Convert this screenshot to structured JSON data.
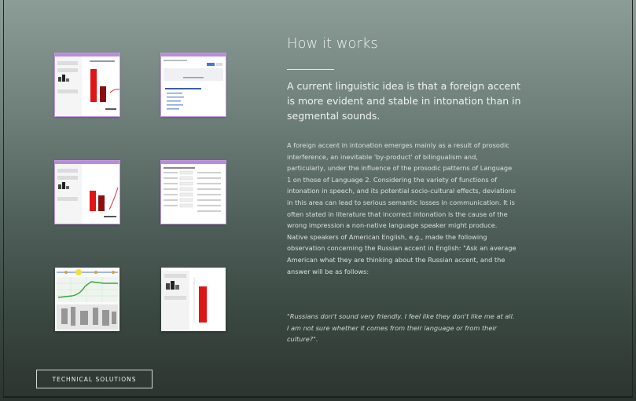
{
  "section": {
    "heading": "How it works",
    "lead": "A current linguistic idea is that a foreign accent is more evident and stable in intonation than in segmental sounds.",
    "body": "A foreign accent in intonation emerges mainly as a result of prosodic interference, an inevitable 'by-product' of bilingualism and, particularly, under the influence of the prosodic patterns of Language 1 on those of Language 2. Considering the variety of functions of intonation in speech, and its potential socio-cultural effects, deviations in this area can lead to serious semantic losses in communication. It is often stated in literature that incorrect intonation is the cause of the wrong impression a non-native language speaker might produce. Native speakers of American English, e.g., made the following observation concerning the Russian accent in English: \"Ask an average American what they are thinking about the Russian accent, and the answer will be as follows:",
    "quote": "\"Russians don't sound very friendly. I feel like they don't like me at all. I am not sure whether it comes from their language or from their culture?\"."
  },
  "screenshots": {
    "thumb_2": {
      "title": "English"
    }
  },
  "buttons": {
    "technical_solutions": "TECHNICAL SOLUTIONS"
  },
  "colors": {
    "accent_purple": "#b98bd8",
    "bar_red": "#e01515",
    "bar_dark_red": "#8b0f0f",
    "blue_button": "#3a7bd5"
  }
}
